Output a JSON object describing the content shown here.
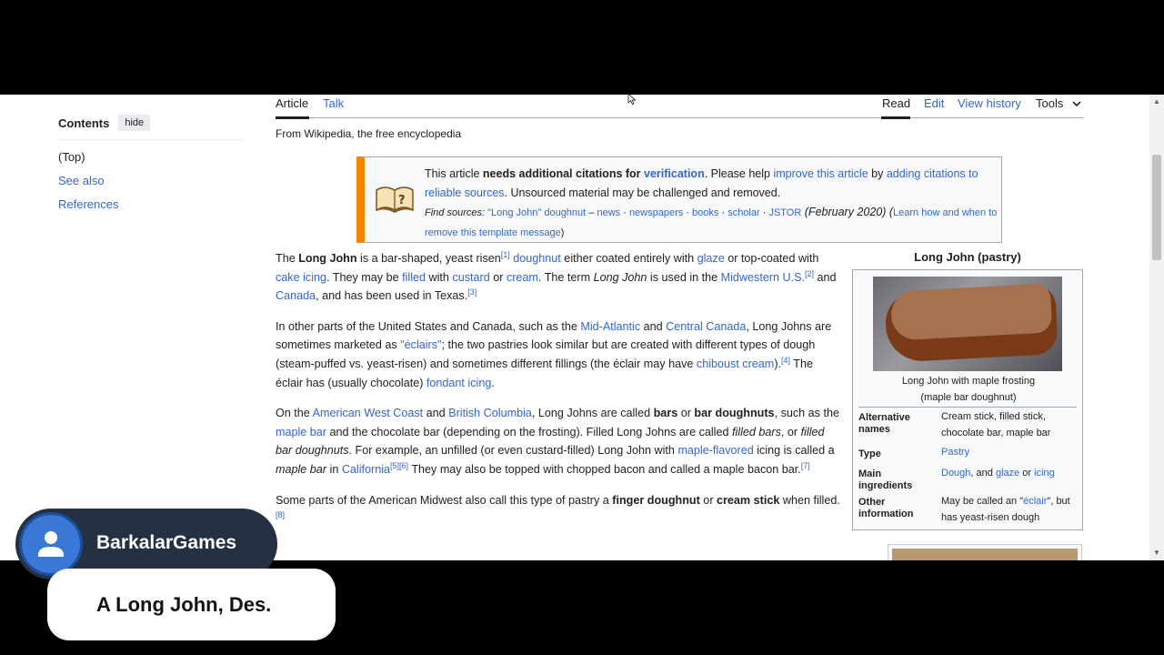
{
  "toc": {
    "title": "Contents",
    "hide_label": "hide",
    "items": [
      "(Top)",
      "See also",
      "References"
    ]
  },
  "tabs": {
    "article": "Article",
    "talk": "Talk",
    "read": "Read",
    "edit": "Edit",
    "view_history": "View history",
    "tools": "Tools"
  },
  "from_wiki": "From Wikipedia, the free encyclopedia",
  "ambox": {
    "t1": "This article ",
    "t2": "needs additional citations for ",
    "t3": "verification",
    "t4": ". Please help ",
    "t5": "improve this article",
    "t6": " by ",
    "t7": "adding citations to reliable sources",
    "t8": ". Unsourced material may be challenged and removed.",
    "s1": "Find sources: ",
    "s2": "\"Long John\" doughnut",
    "s3": " – ",
    "s4": "news",
    "s5": " · ",
    "s6": "newspapers",
    "s8": "books",
    "s10": "scholar",
    "s12": "JSTOR",
    "s13": " (February 2020) (",
    "s14": "Learn how and when to remove this template message",
    "s15": ")"
  },
  "p1": {
    "a": "The ",
    "b": "Long John",
    "c": " is a bar-shaped, yeast risen",
    "ref1": "[1]",
    "d": "doughnut",
    "e": " either coated entirely with ",
    "f": "glaze",
    "g": " or top-coated with ",
    "h": "cake icing",
    "i": ". They may be ",
    "j": "filled",
    "k": " with ",
    "l": "custard",
    "m": " or ",
    "n": "cream",
    "o": ". The term ",
    "p": "Long John",
    "q": " is used in the ",
    "r": "Midwestern U.S.",
    "ref2": "[2]",
    "s": " and ",
    "t": "Canada",
    "u": ", and has been used in Texas.",
    "ref3": "[3]"
  },
  "p2": {
    "a": "In other parts of the United States and Canada, such as the ",
    "b": "Mid-Atlantic",
    "c": " and ",
    "d": "Central Canada",
    "e": ", Long Johns are sometimes marketed as ",
    "f": "\"éclairs\"",
    "g": "; the two pastries look similar but are created with different types of dough (steam-puffed vs. yeast-risen) and sometimes different fillings (the éclair may have ",
    "h": "chiboust cream",
    "i": ").",
    "ref4": "[4]",
    "j": " The éclair has (usually chocolate) ",
    "k": "fondant icing",
    "l": "."
  },
  "p3": {
    "a": "On the ",
    "b": "American West Coast",
    "c": " and ",
    "d": "British Columbia",
    "e": ", Long Johns are called ",
    "f": "bars",
    "g": " or ",
    "h": "bar doughnuts",
    "i": ", such as the ",
    "j": "maple bar",
    "k": " and the chocolate bar (depending on the frosting). Filled Long Johns are called ",
    "l": "filled bars",
    "m": ", or ",
    "n": "filled bar doughnuts",
    "o": ". For example, an unfilled (or even custard-filled) Long John with ",
    "p": "maple-flavored",
    "q": " icing is called a ",
    "r": "maple bar",
    "s": " in ",
    "t": "California",
    "ref5": "[5][6]",
    "u": " They may also be topped with chopped bacon and called a maple bacon bar.",
    "ref7": "[7]"
  },
  "p4": {
    "a": "Some parts of the American Midwest also call this type of pastry a ",
    "b": "finger doughnut",
    "c": " or ",
    "d": "cream stick",
    "e": " when filled.",
    "ref8": "[8]"
  },
  "infobox": {
    "title": "Long John (pastry)",
    "caption1": "Long John with maple frosting",
    "caption2": "(maple bar doughnut)",
    "alt_label": "Alternative names",
    "alt_value": "Cream stick, filled stick, chocolate bar, maple bar",
    "type_label": "Type",
    "type_value": "Pastry",
    "ing_label": "Main ingredients",
    "ing_1": "Dough",
    "ing_2": ", and ",
    "ing_3": "glaze",
    "ing_4": " or ",
    "ing_5": "icing",
    "other_label": "Other information",
    "other_1": "May be called an \"",
    "other_2": "éclair",
    "other_3": "\", but has yeast-risen dough"
  },
  "overlay": {
    "username": "BarkalarGames",
    "message": "A Long John, Des."
  }
}
